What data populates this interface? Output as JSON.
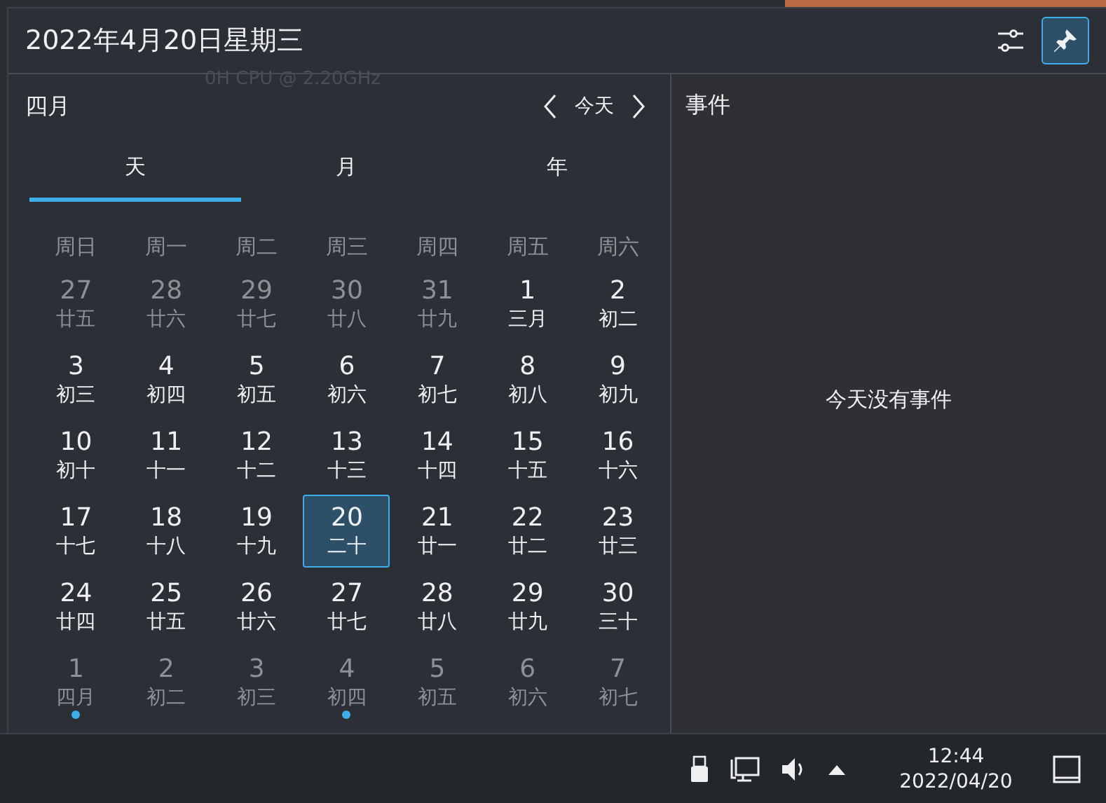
{
  "background_text": "0H CPU @ 2.20GHz",
  "header": {
    "title": "2022年4月20日星期三",
    "pinned": true
  },
  "calendar": {
    "month": "四月",
    "today_button": "今天",
    "tabs": [
      {
        "label": "天",
        "selected": true
      },
      {
        "label": "月",
        "selected": false
      },
      {
        "label": "年",
        "selected": false
      }
    ],
    "weekdays": [
      "周日",
      "周一",
      "周二",
      "周三",
      "周四",
      "周五",
      "周六"
    ],
    "weeks": [
      [
        {
          "day": "27",
          "lunar": "廿五",
          "in_month": false,
          "today": false,
          "event": false
        },
        {
          "day": "28",
          "lunar": "廿六",
          "in_month": false,
          "today": false,
          "event": false
        },
        {
          "day": "29",
          "lunar": "廿七",
          "in_month": false,
          "today": false,
          "event": false
        },
        {
          "day": "30",
          "lunar": "廿八",
          "in_month": false,
          "today": false,
          "event": false
        },
        {
          "day": "31",
          "lunar": "廿九",
          "in_month": false,
          "today": false,
          "event": false
        },
        {
          "day": "1",
          "lunar": "三月",
          "in_month": true,
          "today": false,
          "event": false
        },
        {
          "day": "2",
          "lunar": "初二",
          "in_month": true,
          "today": false,
          "event": false
        }
      ],
      [
        {
          "day": "3",
          "lunar": "初三",
          "in_month": true,
          "today": false,
          "event": false
        },
        {
          "day": "4",
          "lunar": "初四",
          "in_month": true,
          "today": false,
          "event": false
        },
        {
          "day": "5",
          "lunar": "初五",
          "in_month": true,
          "today": false,
          "event": false
        },
        {
          "day": "6",
          "lunar": "初六",
          "in_month": true,
          "today": false,
          "event": false
        },
        {
          "day": "7",
          "lunar": "初七",
          "in_month": true,
          "today": false,
          "event": false
        },
        {
          "day": "8",
          "lunar": "初八",
          "in_month": true,
          "today": false,
          "event": false
        },
        {
          "day": "9",
          "lunar": "初九",
          "in_month": true,
          "today": false,
          "event": false
        }
      ],
      [
        {
          "day": "10",
          "lunar": "初十",
          "in_month": true,
          "today": false,
          "event": false
        },
        {
          "day": "11",
          "lunar": "十一",
          "in_month": true,
          "today": false,
          "event": false
        },
        {
          "day": "12",
          "lunar": "十二",
          "in_month": true,
          "today": false,
          "event": false
        },
        {
          "day": "13",
          "lunar": "十三",
          "in_month": true,
          "today": false,
          "event": false
        },
        {
          "day": "14",
          "lunar": "十四",
          "in_month": true,
          "today": false,
          "event": false
        },
        {
          "day": "15",
          "lunar": "十五",
          "in_month": true,
          "today": false,
          "event": false
        },
        {
          "day": "16",
          "lunar": "十六",
          "in_month": true,
          "today": false,
          "event": false
        }
      ],
      [
        {
          "day": "17",
          "lunar": "十七",
          "in_month": true,
          "today": false,
          "event": false
        },
        {
          "day": "18",
          "lunar": "十八",
          "in_month": true,
          "today": false,
          "event": false
        },
        {
          "day": "19",
          "lunar": "十九",
          "in_month": true,
          "today": false,
          "event": false
        },
        {
          "day": "20",
          "lunar": "二十",
          "in_month": true,
          "today": true,
          "event": false
        },
        {
          "day": "21",
          "lunar": "廿一",
          "in_month": true,
          "today": false,
          "event": false
        },
        {
          "day": "22",
          "lunar": "廿二",
          "in_month": true,
          "today": false,
          "event": false
        },
        {
          "day": "23",
          "lunar": "廿三",
          "in_month": true,
          "today": false,
          "event": false
        }
      ],
      [
        {
          "day": "24",
          "lunar": "廿四",
          "in_month": true,
          "today": false,
          "event": false
        },
        {
          "day": "25",
          "lunar": "廿五",
          "in_month": true,
          "today": false,
          "event": false
        },
        {
          "day": "26",
          "lunar": "廿六",
          "in_month": true,
          "today": false,
          "event": false
        },
        {
          "day": "27",
          "lunar": "廿七",
          "in_month": true,
          "today": false,
          "event": false
        },
        {
          "day": "28",
          "lunar": "廿八",
          "in_month": true,
          "today": false,
          "event": false
        },
        {
          "day": "29",
          "lunar": "廿九",
          "in_month": true,
          "today": false,
          "event": false
        },
        {
          "day": "30",
          "lunar": "三十",
          "in_month": true,
          "today": false,
          "event": false
        }
      ],
      [
        {
          "day": "1",
          "lunar": "四月",
          "in_month": false,
          "today": false,
          "event": true
        },
        {
          "day": "2",
          "lunar": "初二",
          "in_month": false,
          "today": false,
          "event": false
        },
        {
          "day": "3",
          "lunar": "初三",
          "in_month": false,
          "today": false,
          "event": false
        },
        {
          "day": "4",
          "lunar": "初四",
          "in_month": false,
          "today": false,
          "event": true
        },
        {
          "day": "5",
          "lunar": "初五",
          "in_month": false,
          "today": false,
          "event": false
        },
        {
          "day": "6",
          "lunar": "初六",
          "in_month": false,
          "today": false,
          "event": false
        },
        {
          "day": "7",
          "lunar": "初七",
          "in_month": false,
          "today": false,
          "event": false
        }
      ]
    ]
  },
  "events": {
    "title": "事件",
    "empty_message": "今天没有事件"
  },
  "taskbar": {
    "time": "12:44",
    "date": "2022/04/20"
  }
}
